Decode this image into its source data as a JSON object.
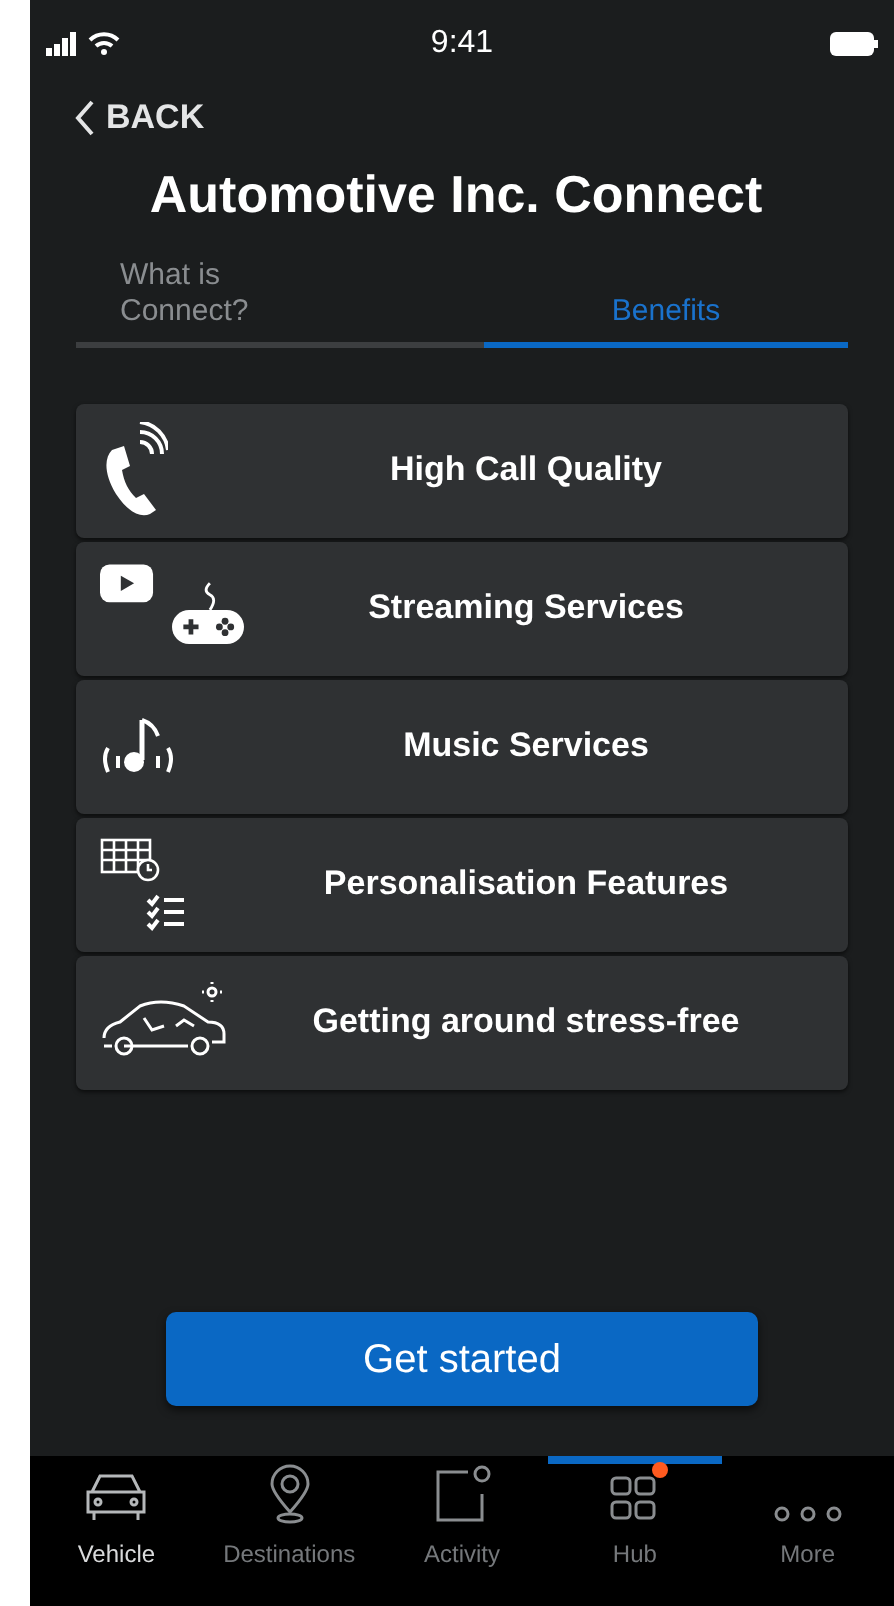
{
  "status_bar": {
    "time": "9:41"
  },
  "back": {
    "label": "BACK"
  },
  "title": "Automotive Inc. Connect",
  "tabs": [
    {
      "label": "What is Connect?",
      "selected": false
    },
    {
      "label": "Benefits",
      "selected": true
    }
  ],
  "benefits": [
    {
      "kind": "call",
      "label": "High Call Quality"
    },
    {
      "kind": "streaming",
      "label": "Streaming Services"
    },
    {
      "kind": "music",
      "label": "Music Services"
    },
    {
      "kind": "personalisation",
      "label": "Personalisation Features"
    },
    {
      "kind": "car",
      "label": "Getting around stress-free"
    }
  ],
  "primary_button": {
    "label": "Get started"
  },
  "tab_bar": [
    {
      "kind": "vehicle",
      "label": "Vehicle",
      "selected": true,
      "indicator": false,
      "badge": false
    },
    {
      "kind": "destinations",
      "label": "Destinations",
      "selected": false,
      "indicator": false,
      "badge": false
    },
    {
      "kind": "activity",
      "label": "Activity",
      "selected": false,
      "indicator": false,
      "badge": false
    },
    {
      "kind": "hub",
      "label": "Hub",
      "selected": false,
      "indicator": true,
      "badge": true
    },
    {
      "kind": "more",
      "label": "More",
      "selected": false,
      "indicator": false,
      "badge": false
    }
  ]
}
